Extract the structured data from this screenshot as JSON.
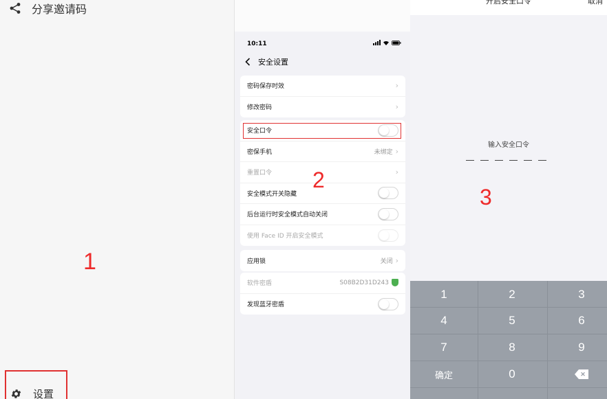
{
  "panel1": {
    "share_label": "分享邀请码",
    "settings_label": "设置",
    "annotation": "1"
  },
  "panel2": {
    "status_time": "10:11",
    "nav_title": "安全设置",
    "annotation": "2",
    "groups": [
      [
        {
          "label": "密码保存时效",
          "type": "chevron"
        },
        {
          "label": "修改密码",
          "type": "chevron"
        }
      ],
      [
        {
          "label": "安全口令",
          "type": "toggle"
        },
        {
          "label": "密保手机",
          "value": "未绑定",
          "type": "chevron"
        },
        {
          "label": "重置口令",
          "type": "chevron",
          "dim": true
        },
        {
          "label": "安全模式开关隐藏",
          "type": "toggle"
        },
        {
          "label": "后台运行时安全模式自动关闭",
          "type": "toggle"
        },
        {
          "label": "使用 Face ID 开启安全模式",
          "type": "toggle",
          "dim": true
        }
      ],
      [
        {
          "label": "应用锁",
          "value": "关闭",
          "type": "chevron"
        }
      ],
      [
        {
          "label": "软件密盾",
          "value": "S08B2D31D243",
          "type": "shield",
          "dim": true
        },
        {
          "label": "发现蓝牙密盾",
          "type": "toggle"
        }
      ]
    ]
  },
  "panel3": {
    "title": "开启安全口令",
    "cancel_label": "取消",
    "prompt": "输入安全口令",
    "annotation": "3",
    "keys": [
      "1",
      "2",
      "3",
      "4",
      "5",
      "6",
      "7",
      "8",
      "9",
      "确定",
      "0",
      "⌫"
    ]
  },
  "colors": {
    "annotation_red": "#ee2b2b",
    "keypad_bg": "#9aa0a8"
  }
}
